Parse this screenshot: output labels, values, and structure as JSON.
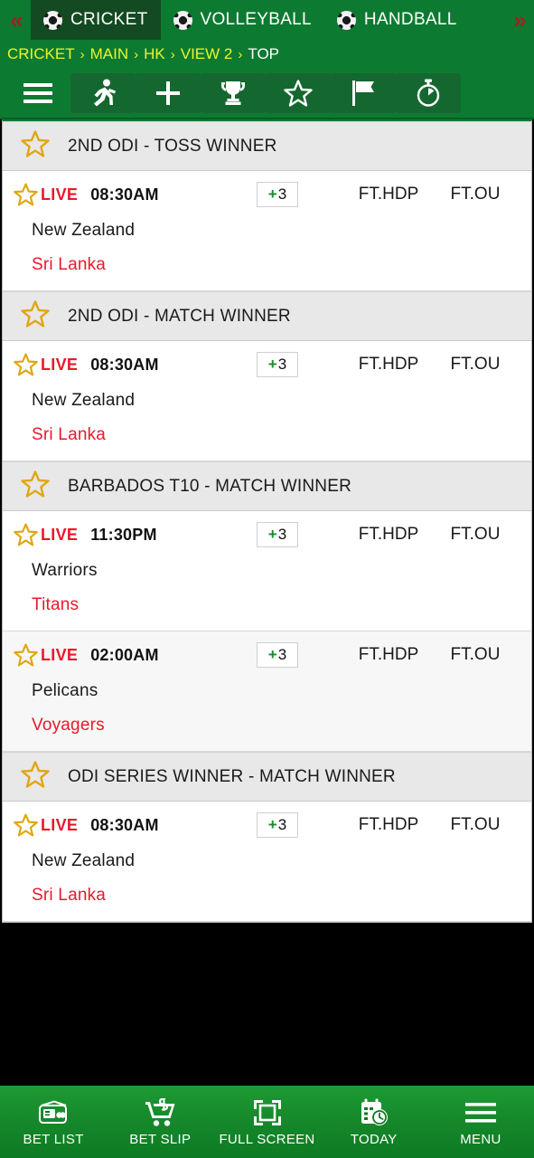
{
  "sportbar": {
    "prev_icon": "chevron-left-double-icon",
    "next_icon": "chevron-right-double-icon",
    "prev_label": "«",
    "next_label": "»",
    "tabs": [
      {
        "label": "CRICKET",
        "icon": "soccer-ball-icon",
        "active": true
      },
      {
        "label": "VOLLEYBALL",
        "icon": "soccer-ball-icon",
        "active": false
      },
      {
        "label": "HANDBALL",
        "icon": "soccer-ball-icon",
        "active": false
      }
    ]
  },
  "breadcrumb": {
    "separator": "›",
    "items": [
      {
        "label": "CRICKET",
        "current": false
      },
      {
        "label": "MAIN",
        "current": false
      },
      {
        "label": "HK",
        "current": false
      },
      {
        "label": "VIEW 2",
        "current": false
      },
      {
        "label": "TOP",
        "current": true
      }
    ]
  },
  "toolbar": {
    "items": [
      {
        "name": "menu-icon",
        "label": "Menu",
        "boxed": false
      },
      {
        "name": "running-person-icon",
        "label": "Live",
        "boxed": true
      },
      {
        "name": "plus-icon",
        "label": "Add",
        "boxed": true
      },
      {
        "name": "trophy-icon",
        "label": "Results",
        "boxed": true
      },
      {
        "name": "star-icon",
        "label": "Favourites",
        "boxed": true
      },
      {
        "name": "flag-icon",
        "label": "Leagues",
        "boxed": true
      },
      {
        "name": "stopwatch-icon",
        "label": "Timer",
        "boxed": true
      }
    ]
  },
  "columns": {
    "more_plus": "+",
    "more_count": "3",
    "hdp": "FT.HDP",
    "ou": "FT.OU"
  },
  "sections": [
    {
      "title": "2ND ODI - TOSS WINNER",
      "matches": [
        {
          "status": "LIVE",
          "time": "08:30AM",
          "more_plus": "+",
          "more_count": "3",
          "hdp": "FT.HDP",
          "ou": "FT.OU",
          "home": "New Zealand",
          "away": "Sri Lanka"
        }
      ]
    },
    {
      "title": "2ND ODI - MATCH WINNER",
      "matches": [
        {
          "status": "LIVE",
          "time": "08:30AM",
          "more_plus": "+",
          "more_count": "3",
          "hdp": "FT.HDP",
          "ou": "FT.OU",
          "home": "New Zealand",
          "away": "Sri Lanka"
        }
      ]
    },
    {
      "title": "BARBADOS T10 - MATCH WINNER",
      "matches": [
        {
          "status": "LIVE",
          "time": "11:30PM",
          "more_plus": "+",
          "more_count": "3",
          "hdp": "FT.HDP",
          "ou": "FT.OU",
          "home": "Warriors",
          "away": "Titans"
        },
        {
          "status": "LIVE",
          "time": "02:00AM",
          "more_plus": "+",
          "more_count": "3",
          "hdp": "FT.HDP",
          "ou": "FT.OU",
          "home": "Pelicans",
          "away": "Voyagers"
        }
      ]
    },
    {
      "title": "ODI SERIES WINNER - MATCH WINNER",
      "matches": [
        {
          "status": "LIVE",
          "time": "08:30AM",
          "more_plus": "+",
          "more_count": "3",
          "hdp": "FT.HDP",
          "ou": "FT.OU",
          "home": "New Zealand",
          "away": "Sri Lanka"
        }
      ]
    }
  ],
  "bottomnav": {
    "items": [
      {
        "label": "BET LIST",
        "icon": "wallet-cards-icon"
      },
      {
        "label": "BET SLIP",
        "icon": "shopping-cart-dollar-icon"
      },
      {
        "label": "FULL SCREEN",
        "icon": "fullscreen-expand-icon"
      },
      {
        "label": "TODAY",
        "icon": "calendar-clock-icon"
      },
      {
        "label": "MENU",
        "icon": "hamburger-menu-icon"
      }
    ]
  },
  "colors": {
    "brand_green": "#0d7a32",
    "tab_active": "#134a22",
    "breadcrumb_yellow": "#e9f52a",
    "live_red": "#e8192c",
    "star_gold": "#e0a712",
    "arrow_red": "#a32020",
    "plus_green": "#1a8a2a"
  }
}
